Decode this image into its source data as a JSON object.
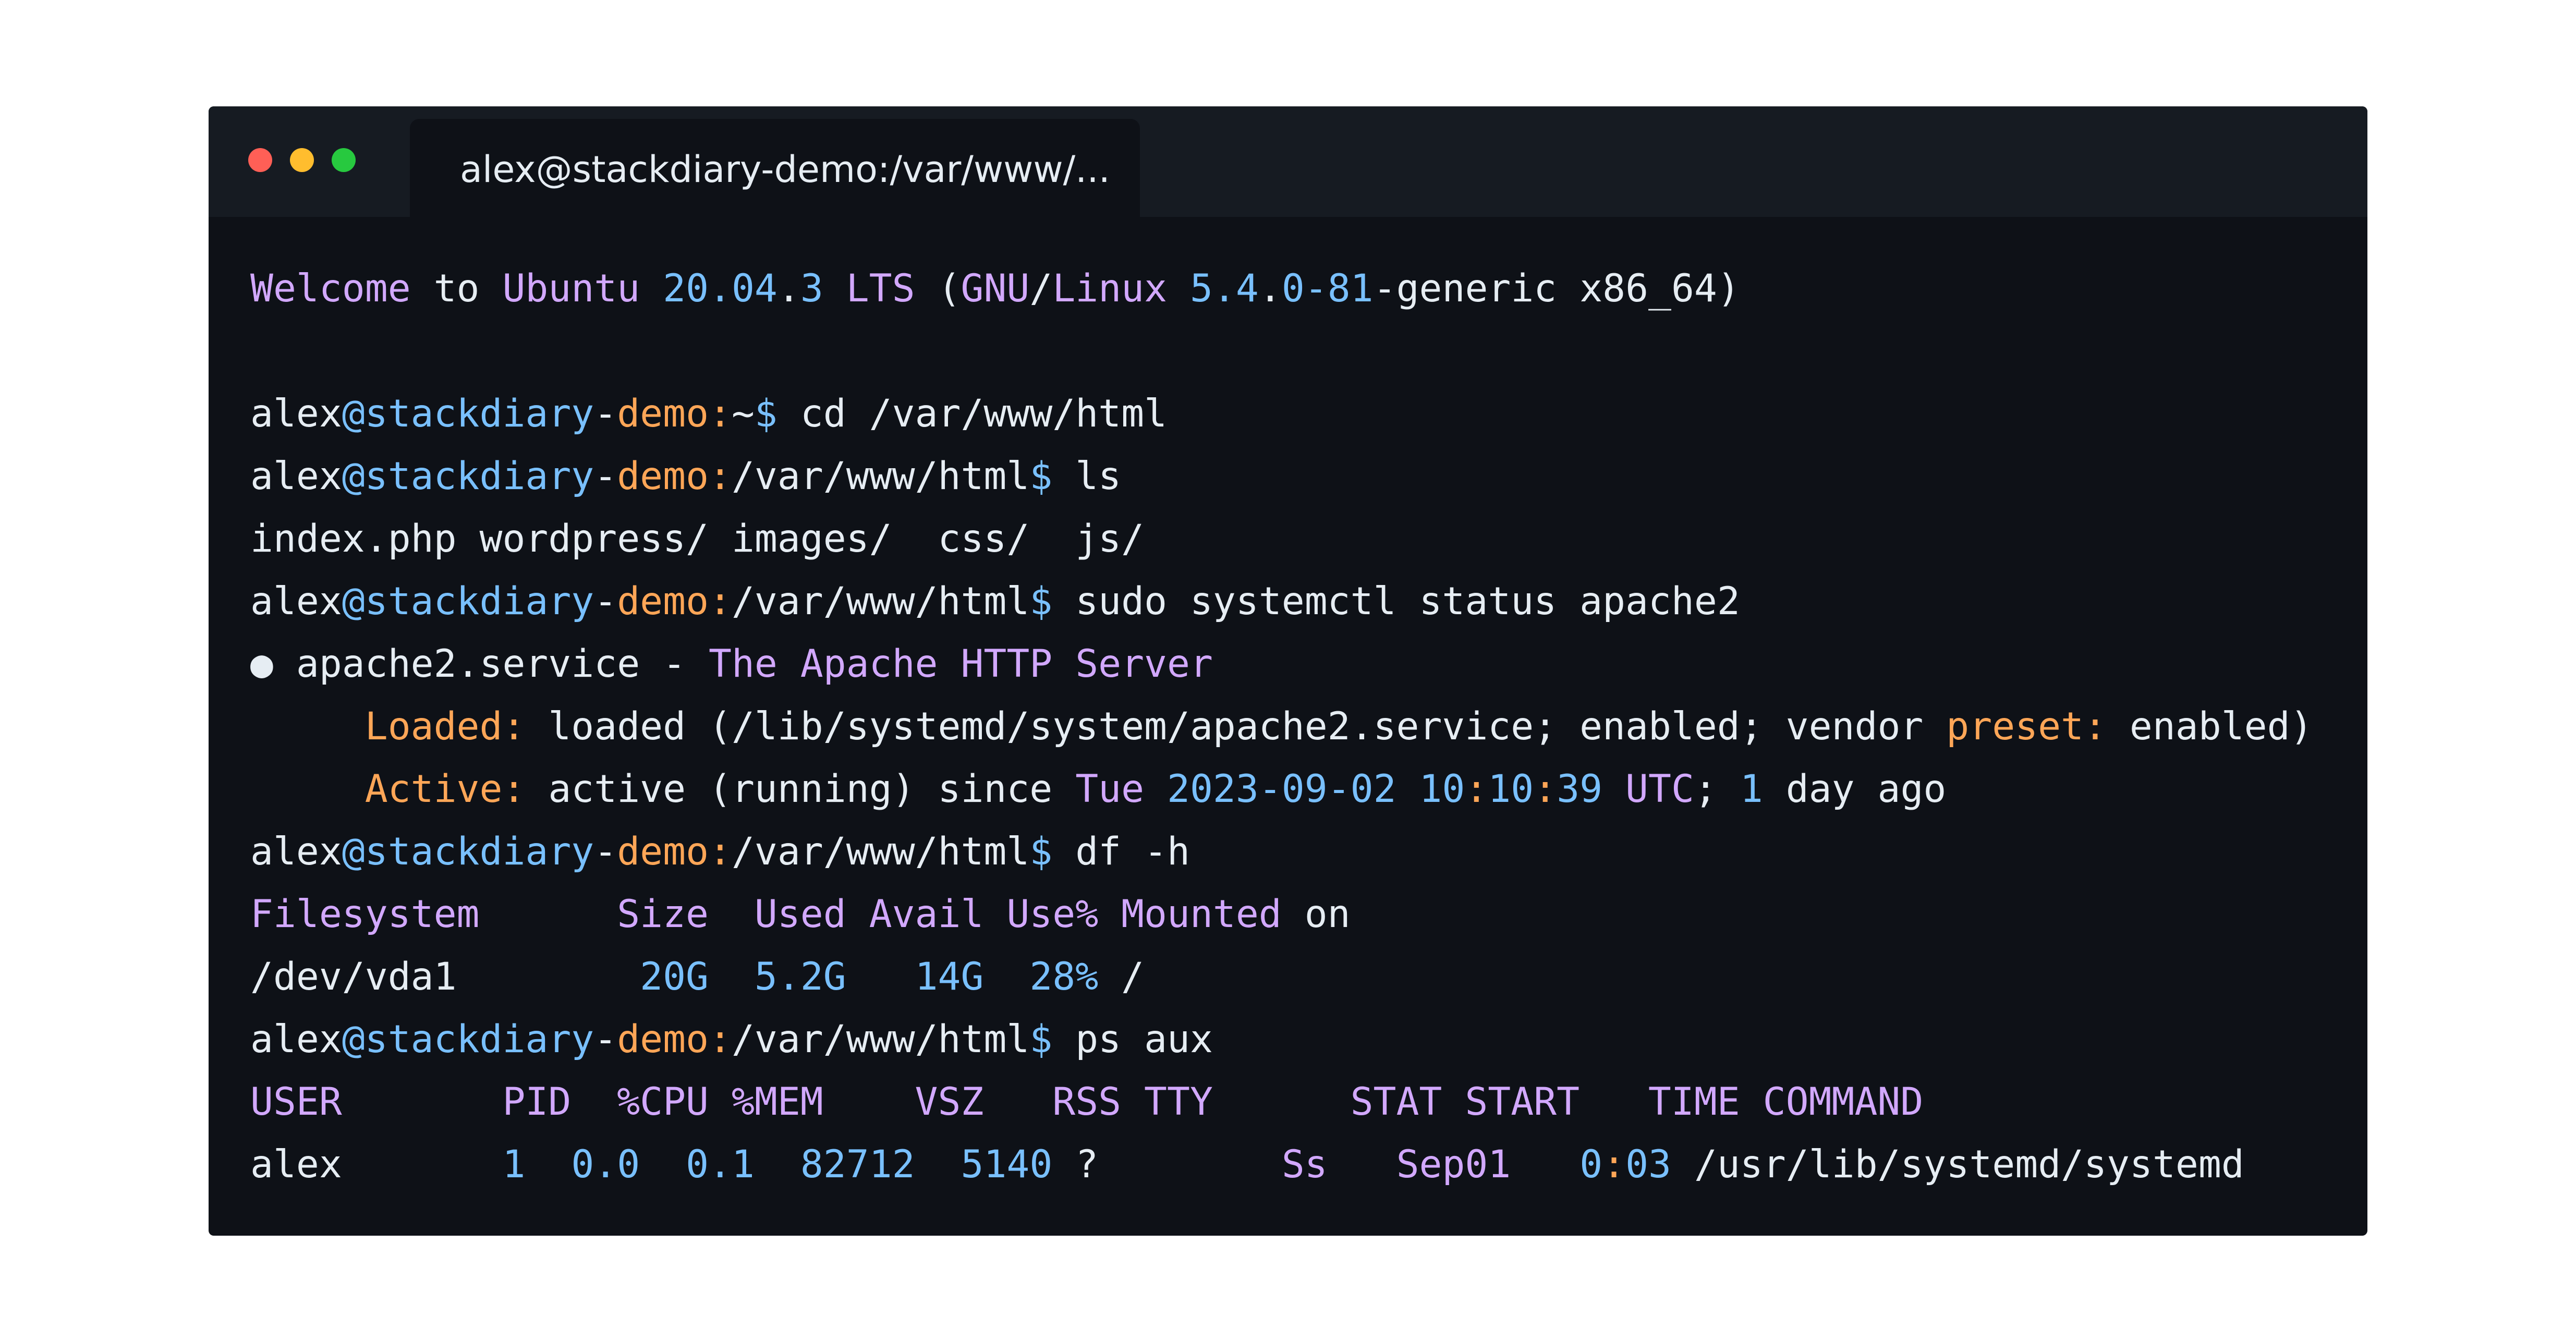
{
  "window": {
    "tab_title": "alex@stackdiary-demo:/var/www/...",
    "traffic_lights": [
      "close-dot",
      "minimize-dot",
      "maximize-dot"
    ]
  },
  "colors": {
    "background": "#0e1117",
    "titlebar": "#161b22",
    "purple": "#d2a8ff",
    "blue": "#79c0ff",
    "orange": "#ffa657",
    "text": "#e6edf3"
  },
  "terminal": {
    "lines": [
      [
        [
          "p",
          "Welcome"
        ],
        [
          "w",
          " to "
        ],
        [
          "p",
          "Ubuntu"
        ],
        [
          "w",
          " "
        ],
        [
          "b",
          "20.04"
        ],
        [
          "w",
          "."
        ],
        [
          "b",
          "3"
        ],
        [
          "w",
          " "
        ],
        [
          "p",
          "LTS"
        ],
        [
          "w",
          " ("
        ],
        [
          "p",
          "GNU"
        ],
        [
          "w",
          "/"
        ],
        [
          "p",
          "Linux"
        ],
        [
          "w",
          " "
        ],
        [
          "b",
          "5.4"
        ],
        [
          "w",
          "."
        ],
        [
          "b",
          "0-81"
        ],
        [
          "w",
          "-generic x86_64)"
        ]
      ],
      [],
      [
        [
          "w",
          "alex"
        ],
        [
          "b",
          "@stackdiary"
        ],
        [
          "w",
          "-"
        ],
        [
          "o",
          "demo:"
        ],
        [
          "w",
          "~"
        ],
        [
          "b",
          "$"
        ],
        [
          "w",
          " cd /var/www/html"
        ]
      ],
      [
        [
          "w",
          "alex"
        ],
        [
          "b",
          "@stackdiary"
        ],
        [
          "w",
          "-"
        ],
        [
          "o",
          "demo:"
        ],
        [
          "w",
          "/var/www/html"
        ],
        [
          "b",
          "$"
        ],
        [
          "w",
          " ls"
        ]
      ],
      [
        [
          "w",
          "index.php wordpress/ images/  css/  js/"
        ]
      ],
      [
        [
          "w",
          "alex"
        ],
        [
          "b",
          "@stackdiary"
        ],
        [
          "w",
          "-"
        ],
        [
          "o",
          "demo:"
        ],
        [
          "w",
          "/var/www/html"
        ],
        [
          "b",
          "$"
        ],
        [
          "w",
          " sudo systemctl status apache2"
        ]
      ],
      [
        [
          "w",
          "● apache2.service - "
        ],
        [
          "p",
          "The Apache HTTP Server"
        ]
      ],
      [
        [
          "w",
          "     "
        ],
        [
          "o",
          "Loaded:"
        ],
        [
          "w",
          " loaded (/lib/systemd/system/apache2.service; enabled; vendor "
        ],
        [
          "o",
          "preset:"
        ],
        [
          "w",
          " enabled)"
        ]
      ],
      [
        [
          "w",
          "     "
        ],
        [
          "o",
          "Active:"
        ],
        [
          "w",
          " active (running) since "
        ],
        [
          "p",
          "Tue"
        ],
        [
          "w",
          " "
        ],
        [
          "b",
          "2023-09-02"
        ],
        [
          "w",
          " "
        ],
        [
          "b",
          "10"
        ],
        [
          "o",
          ":"
        ],
        [
          "b",
          "10"
        ],
        [
          "o",
          ":"
        ],
        [
          "b",
          "39"
        ],
        [
          "w",
          " "
        ],
        [
          "p",
          "UTC"
        ],
        [
          "w",
          "; "
        ],
        [
          "b",
          "1"
        ],
        [
          "w",
          " day ago"
        ]
      ],
      [
        [
          "w",
          "alex"
        ],
        [
          "b",
          "@stackdiary"
        ],
        [
          "w",
          "-"
        ],
        [
          "o",
          "demo:"
        ],
        [
          "w",
          "/var/www/html"
        ],
        [
          "b",
          "$"
        ],
        [
          "w",
          " df -h"
        ]
      ],
      [
        [
          "p",
          "Filesystem      Size  Used Avail Use% Mounted"
        ],
        [
          "w",
          " on"
        ]
      ],
      [
        [
          "w",
          "/dev/vda1        "
        ],
        [
          "b",
          "20G"
        ],
        [
          "w",
          "  "
        ],
        [
          "b",
          "5.2G"
        ],
        [
          "w",
          "   "
        ],
        [
          "b",
          "14G"
        ],
        [
          "w",
          "  "
        ],
        [
          "b",
          "28%"
        ],
        [
          "w",
          " /"
        ]
      ],
      [
        [
          "w",
          "alex"
        ],
        [
          "b",
          "@stackdiary"
        ],
        [
          "w",
          "-"
        ],
        [
          "o",
          "demo:"
        ],
        [
          "w",
          "/var/www/html"
        ],
        [
          "b",
          "$"
        ],
        [
          "w",
          " ps aux"
        ]
      ],
      [
        [
          "p",
          "USER       PID  %CPU %MEM    VSZ   RSS TTY      STAT START   TIME COMMAND"
        ]
      ],
      [
        [
          "w",
          "alex       "
        ],
        [
          "b",
          "1"
        ],
        [
          "w",
          "  "
        ],
        [
          "b",
          "0.0"
        ],
        [
          "w",
          "  "
        ],
        [
          "b",
          "0.1"
        ],
        [
          "w",
          "  "
        ],
        [
          "b",
          "82712"
        ],
        [
          "w",
          "  "
        ],
        [
          "b",
          "5140"
        ],
        [
          "w",
          " ?        "
        ],
        [
          "p",
          "Ss"
        ],
        [
          "w",
          "   "
        ],
        [
          "p",
          "Sep01"
        ],
        [
          "w",
          "   "
        ],
        [
          "b",
          "0"
        ],
        [
          "o",
          ":"
        ],
        [
          "b",
          "03"
        ],
        [
          "w",
          " /usr/lib/systemd/systemd"
        ]
      ]
    ]
  }
}
